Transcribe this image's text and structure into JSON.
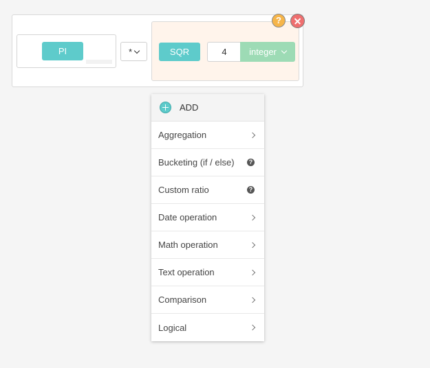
{
  "formula": {
    "left_operand_label": "PI",
    "operator": "*",
    "function_label": "SQR",
    "argument_value": "4",
    "argument_type": "integer",
    "help_icon_text": "?"
  },
  "menu": {
    "add_label": "ADD",
    "items": [
      {
        "label": "Aggregation",
        "icon": "chevron-right-icon"
      },
      {
        "label": "Bucketing (if / else)",
        "icon": "help-icon"
      },
      {
        "label": "Custom ratio",
        "icon": "help-icon"
      },
      {
        "label": "Date operation",
        "icon": "chevron-right-icon"
      },
      {
        "label": "Math operation",
        "icon": "chevron-right-icon"
      },
      {
        "label": "Text operation",
        "icon": "chevron-right-icon"
      },
      {
        "label": "Comparison",
        "icon": "chevron-right-icon"
      },
      {
        "label": "Logical",
        "icon": "chevron-right-icon"
      }
    ]
  },
  "colors": {
    "teal": "#5ecbcb",
    "green": "#9ddbb5",
    "orange": "#f6b54a",
    "red": "#ef6f6f",
    "selected_bg": "#fff4eb"
  }
}
